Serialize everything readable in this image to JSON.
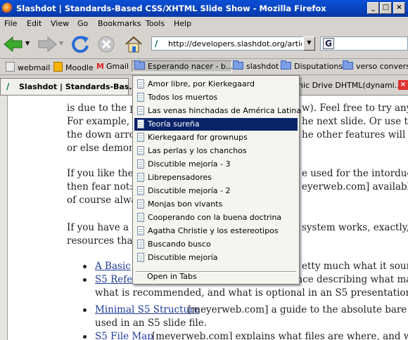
{
  "window": {
    "title": "Slashdot | Standards-Based CSS/XHTML Slide Show - Mozilla Firefox"
  },
  "menubar": [
    "File",
    "Edit",
    "View",
    "Go",
    "Bookmarks",
    "Tools",
    "Help"
  ],
  "toolbar": {
    "url": "http://developers.slashdot.org/article."
  },
  "bookmarks": {
    "items": [
      "webmail",
      "Moodle",
      "Gmail",
      "Esperando nacer - b...",
      "slashdot",
      "Disputations",
      "verso conversos"
    ]
  },
  "tabs": {
    "active": "Slashdot | Standards-Bas...",
    "second": "nic Drive DHTML(dynami..."
  },
  "content": {
    "lines": [
      "is due to the pr",
      "w). Feel free to try any c",
      "For example, y",
      "he next slide. Or use the",
      "the down arrov",
      "he other features will be e",
      "or else demons",
      "If you like the g",
      "e used for the intorducto",
      "then fear not: th",
      "eyerweb.com] available,",
      "of course alway",
      "If you have a ha",
      "system works, exactly, we",
      "resources that r",
      "A Basic",
      "etty much what it sounds",
      "S5 Reference",
      "[meyerweb.com] a full reference describing what markup i",
      "what is recommended, and what is optional in an S5 presentation file.",
      "Minimal S5 Structure",
      "[meyerweb.com] a guide to the absolute bare minin",
      "used in an S5 slide file.",
      "S5 File Map",
      "[meyerweb.com] explains what files are where, and what ea"
    ]
  },
  "dropdown": {
    "items": [
      "Amor libre, por Kierkegaard",
      "Todos los muertos",
      "Las venas hinchadas de América Latina",
      "Teoría sureña",
      "Kierkegaard for grownups",
      "Las perlas y los chanchos",
      "Discutible mejoría - 3",
      "Librepensadores",
      "Discutible mejoría - 2",
      "Monjas bon vivants",
      "Cooperando con la buena doctrina",
      "Agatha Christie y los estereotipos",
      "Buscando busco",
      "Discutible mejoría"
    ],
    "open_in_tabs": "Open in Tabs"
  },
  "colors": {
    "titlebar": "#0a4fd6",
    "selection": "#0a246a",
    "link": "#1e3c9c"
  }
}
